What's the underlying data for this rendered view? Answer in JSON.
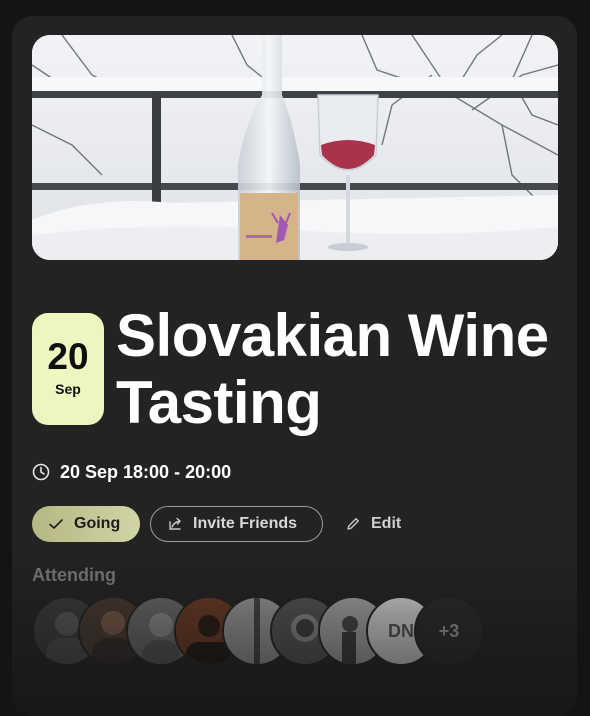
{
  "event": {
    "date_day": "20",
    "date_month": "Sep",
    "title": "Slovakian Wine Tasting",
    "time": "20 Sep 18:00 - 20:00"
  },
  "actions": {
    "going_label": "Going",
    "invite_label": "Invite Friends",
    "edit_label": "Edit"
  },
  "attending": {
    "label": "Attending",
    "initials": "DN",
    "more": "+3"
  },
  "colors": {
    "date_badge": "#eef5bf",
    "going_button": "#c4c595",
    "card": "#232324"
  }
}
